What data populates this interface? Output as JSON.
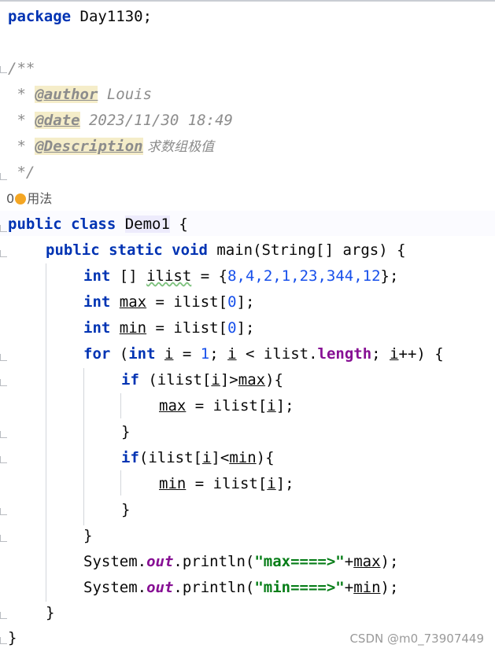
{
  "code": {
    "pkg_kw": "package",
    "pkg_name": " Day1130;",
    "doc_open": "/**",
    "author_prefix": " * ",
    "author_tag": "@author",
    "author_val": " Louis",
    "date_prefix": " * ",
    "date_tag": "@date",
    "date_val": " 2023/11/30 18:49",
    "desc_prefix": " * ",
    "desc_tag": "@Description",
    "desc_val": " 求数组极值",
    "doc_close": " */",
    "usages_count": "0",
    "usages_label": "用法",
    "class_kw": "public class ",
    "class_name": "Demo1",
    "class_brace": " {",
    "main_kw": "public static void",
    "main_sig": " main(String[] args) {",
    "l1_kw": "int",
    "l1_a": " [] ",
    "l1_var": "ilist",
    "l1_b": " = {",
    "l1_nums": "8,4,2,1,23,344,12",
    "l1_c": "};",
    "l2_kw": "int",
    "l2_sp": " ",
    "l2_var": "max",
    "l2_a": " = ilist[",
    "l2_n": "0",
    "l2_b": "];",
    "l3_kw": "int",
    "l3_sp": " ",
    "l3_var": "min",
    "l3_a": " = ilist[",
    "l3_n": "0",
    "l3_b": "];",
    "for_kw": "for",
    "for_a": " (",
    "for_kw2": "int",
    "for_sp": " ",
    "for_i1": "i",
    "for_b": " = ",
    "for_n": "1",
    "for_c": "; ",
    "for_i2": "i",
    "for_d": " < ilist.",
    "for_len": "length",
    "for_e": "; ",
    "for_i3": "i",
    "for_f": "++) {",
    "if1_kw": "if",
    "if1_a": " (ilist[",
    "if1_i": "i",
    "if1_b": "]>",
    "if1_max": "max",
    "if1_c": "){",
    "as1_max": "max",
    "as1_a": " = ilist[",
    "as1_i": "i",
    "as1_b": "];",
    "close1": "}",
    "if2_kw": "if",
    "if2_a": "(ilist[",
    "if2_i": "i",
    "if2_b": "]<",
    "if2_min": "min",
    "if2_c": "){",
    "as2_min": "min",
    "as2_a": " = ilist[",
    "as2_i": "i",
    "as2_b": "];",
    "close2": "}",
    "close_for": "}",
    "p1_a": "System.",
    "p1_out": "out",
    "p1_b": ".println(",
    "p1_str": "\"max====>\"",
    "p1_c": "+",
    "p1_var": "max",
    "p1_d": ");",
    "p2_a": "System.",
    "p2_out": "out",
    "p2_b": ".println(",
    "p2_str": "\"min====>\"",
    "p2_c": "+",
    "p2_var": "min",
    "p2_d": ");",
    "close_main": "}",
    "close_class": "}"
  },
  "watermark": "CSDN @m0_73907449",
  "colors": {
    "keyword": "#0033b3",
    "number": "#1750eb",
    "string": "#067d17",
    "field": "#871094",
    "comment": "#8c8c8c"
  }
}
